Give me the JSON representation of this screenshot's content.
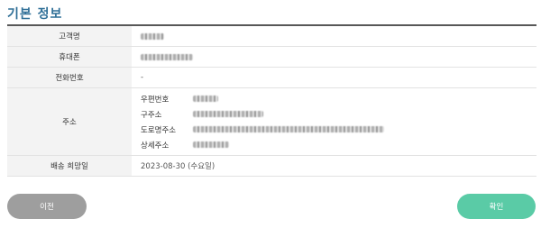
{
  "section": {
    "title": "기본 정보"
  },
  "rows": {
    "customer": {
      "label": "고객명",
      "value_masked": true
    },
    "mobile": {
      "label": "휴대폰",
      "value_masked": true
    },
    "phone": {
      "label": "전화번호",
      "value": "-"
    },
    "address": {
      "label": "주소",
      "postal_label": "우편번호",
      "old_label": "구주소",
      "road_label": "도로명주소",
      "detail_label": "상세주소"
    },
    "date": {
      "label": "배송 희망일",
      "value": "2023-08-30 (수요일)"
    }
  },
  "buttons": {
    "prev": "이전",
    "confirm": "확인"
  },
  "colors": {
    "title": "#2f6f97",
    "prev_button": "#9e9e9e",
    "confirm_button": "#5acba6"
  }
}
